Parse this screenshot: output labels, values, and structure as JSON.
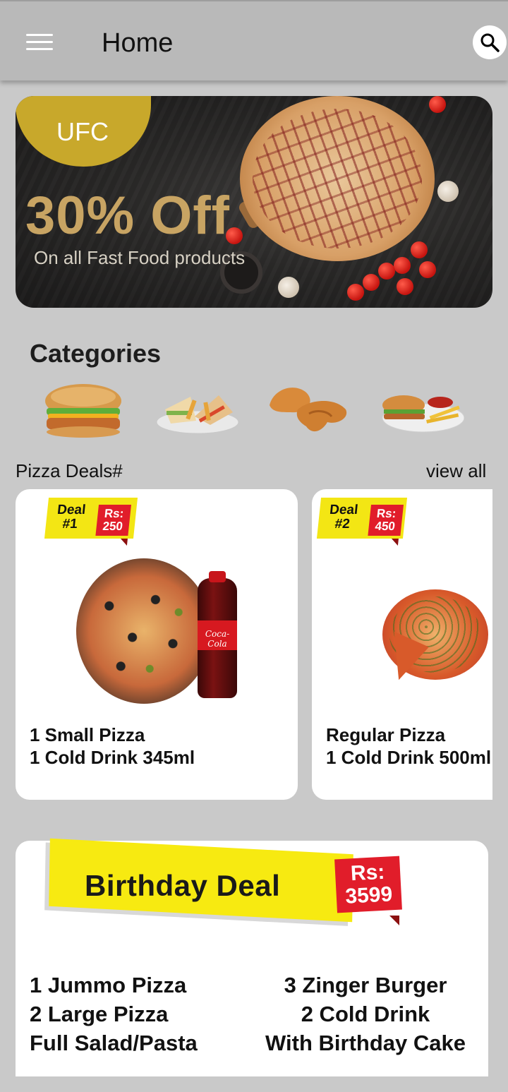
{
  "app_bar": {
    "title": "Home",
    "menu_icon": "hamburger-menu-icon",
    "search_icon": "search-icon"
  },
  "banner": {
    "badge": "UFC",
    "headline": "30% Off",
    "subline": "On all Fast Food products",
    "colors": {
      "badge": "#c8a82b",
      "headline": "#c8a463"
    }
  },
  "categories": {
    "title": "Categories",
    "items": [
      {
        "icon": "burger-icon"
      },
      {
        "icon": "sandwich-platter-icon"
      },
      {
        "icon": "fried-chicken-icon"
      },
      {
        "icon": "burger-fries-platter-icon"
      }
    ]
  },
  "pizza_deals": {
    "label": "Pizza Deals#",
    "view_all": "view all",
    "cards": [
      {
        "deal_line1": "Deal",
        "deal_line2": "#1",
        "price_line1": "Rs:",
        "price_line2": "250",
        "items": "1 Small Pizza\n1 Cold Drink 345ml",
        "drink_label": "Coca-Cola"
      },
      {
        "deal_line1": "Deal",
        "deal_line2": "#2",
        "price_line1": "Rs:",
        "price_line2": "450",
        "items": "Regular Pizza\n1 Cold Drink 500ml"
      }
    ]
  },
  "birthday_deal": {
    "title": "Birthday Deal",
    "price_line1": "Rs:",
    "price_line2": "3599",
    "left_items": [
      "1 Jummo Pizza",
      "2 Large Pizza",
      "Full Salad/Pasta"
    ],
    "right_items": [
      "3 Zinger Burger",
      "2 Cold Drink",
      "With Birthday Cake"
    ]
  }
}
